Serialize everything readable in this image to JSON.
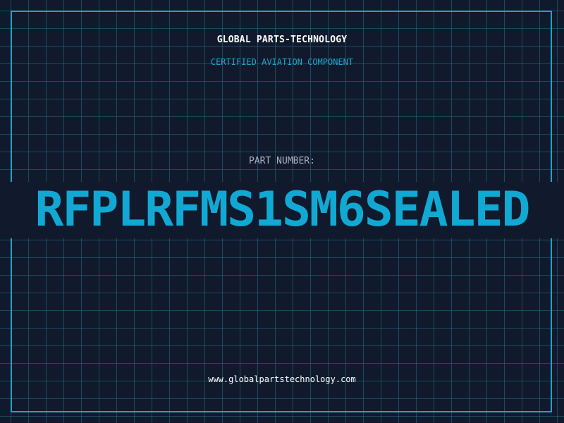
{
  "header": {
    "company": "GLOBAL PARTS-TECHNOLOGY",
    "subtitle": "CERTIFIED AVIATION COMPONENT"
  },
  "part": {
    "label": "PART NUMBER:",
    "number": "RFPLRFMS1SM6SEALED"
  },
  "footer": {
    "url": "www.globalpartstechnology.com"
  },
  "colors": {
    "background": "#111a2d",
    "accent": "#1ba6c9",
    "grid": "#246e8a"
  }
}
